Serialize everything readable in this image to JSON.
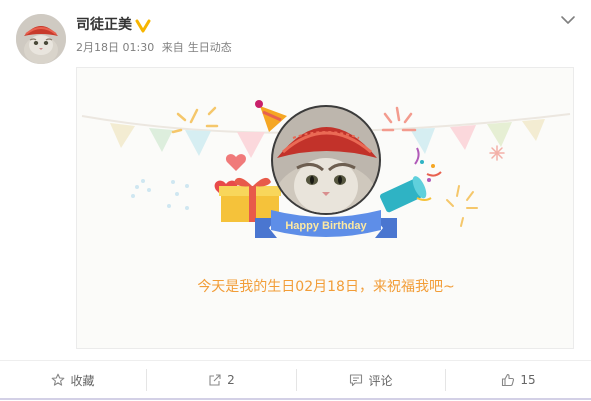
{
  "post": {
    "username": "司徒正美",
    "date": "2月18日 01:30",
    "source_prefix": "来自",
    "source": "生日动态",
    "verified_badge_color": "#f7b500"
  },
  "birthday_card": {
    "ribbon_text": "Happy Birthday",
    "message": "今天是我的生日02月18日，来祝福我吧~",
    "message_color": "#f29d38",
    "ribbon_color": "#5e8ee8"
  },
  "actions": {
    "favorite_label": "收藏",
    "repost_count": "2",
    "comment_label": "评论",
    "like_count": "15"
  },
  "icons": {
    "favorite": "star-icon",
    "repost": "share-arrow-icon",
    "comment": "comment-icon",
    "like": "thumbs-up-icon",
    "more": "chevron-down-icon"
  }
}
